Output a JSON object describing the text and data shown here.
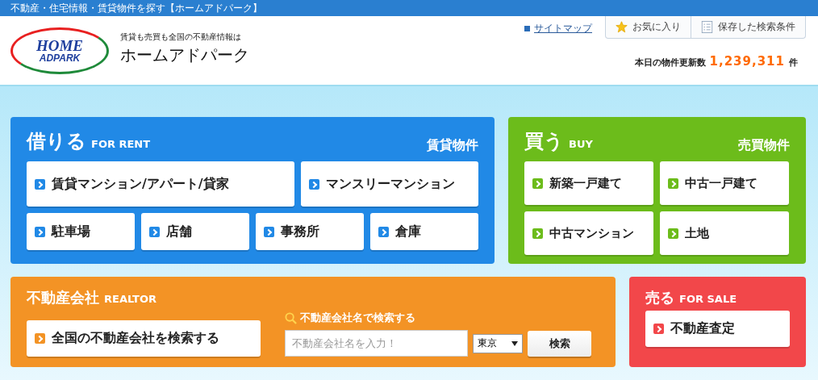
{
  "top_bar": {
    "title": "不動産・住宅情報・賃貸物件を探す【ホームアドパーク】"
  },
  "header": {
    "logo": {
      "line1": "HOME",
      "line2": "ADPARK"
    },
    "tagline": "賃貸も売買も全国の不動産情報は",
    "brand": "ホームアドパーク",
    "sitemap": "サイトマップ",
    "tabs": [
      {
        "kind": "favorite",
        "label": "お気に入り"
      },
      {
        "kind": "saved",
        "label": "保存した検索条件"
      }
    ],
    "update_count": {
      "label": "本日の物件更新数",
      "value": "1,239,311",
      "unit": "件"
    }
  },
  "panels": [
    {
      "kind": "links",
      "color": "#2189e6",
      "title": "借りる",
      "subtitle": "FOR RENT",
      "category": "賃貸物件",
      "links": [
        "賃貸マンション/アパート/貸家",
        "マンスリーマンション",
        "駐車場",
        "店舗",
        "事務所",
        "倉庫"
      ]
    },
    {
      "kind": "links",
      "color": "#6cbc1b",
      "title": "買う",
      "subtitle": "BUY",
      "category": "売買物件",
      "links": [
        "新築一戸建て",
        "中古一戸建て",
        "中古マンション",
        "土地"
      ]
    },
    {
      "kind": "realtor",
      "color": "#f39325",
      "title": "不動産会社",
      "subtitle": "REALTOR",
      "link": "全国の不動産会社を検索する",
      "search": {
        "label": "不動産会社名で検索する",
        "placeholder": "不動産会社名を入力！",
        "region": "東京",
        "button": "検索"
      }
    },
    {
      "kind": "links",
      "color": "#f2474a",
      "title": "売る",
      "subtitle": "FOR SALE",
      "links": [
        "不動産査定"
      ]
    }
  ]
}
